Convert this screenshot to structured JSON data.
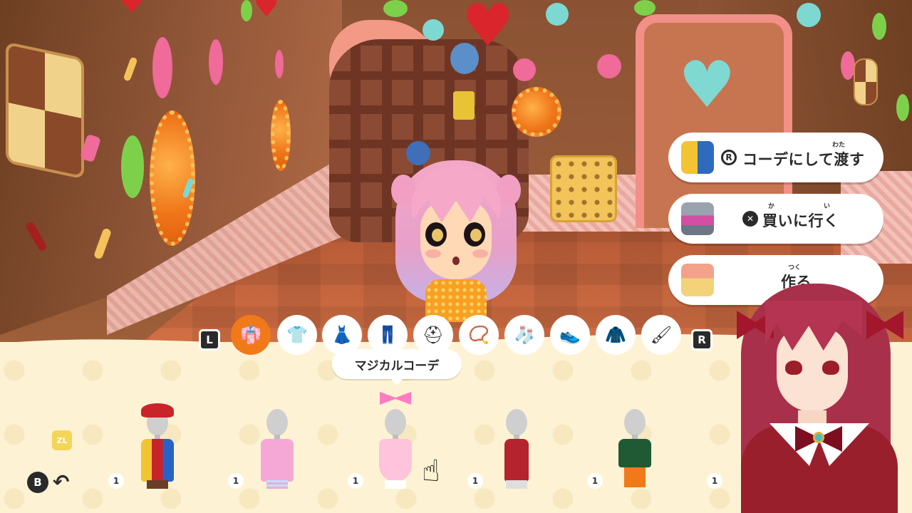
{
  "actions": {
    "coordinate_give": {
      "ruby": "わた",
      "glyph": "R",
      "label": "コーデにして渡す"
    },
    "go_buy": {
      "ruby_ka": "か",
      "ruby_i": "い",
      "glyph": "✕",
      "label": "買いに行く"
    },
    "make": {
      "ruby": "つく",
      "label": "作る"
    }
  },
  "category_tabs": {
    "left_shoulder": "L",
    "right_shoulder": "R",
    "items": [
      {
        "icon": "outfit-set-icon",
        "glyph": "👘",
        "active": true
      },
      {
        "icon": "tshirt-icon",
        "glyph": "👕",
        "active": false
      },
      {
        "icon": "dress-icon",
        "glyph": "👗",
        "active": false
      },
      {
        "icon": "pants-icon",
        "glyph": "👖",
        "active": false
      },
      {
        "icon": "hat-icon",
        "glyph": "⛑",
        "active": false
      },
      {
        "icon": "necklace-icon",
        "glyph": "📿",
        "active": false
      },
      {
        "icon": "sock-icon",
        "glyph": "🧦",
        "active": false
      },
      {
        "icon": "shoe-icon",
        "glyph": "👟",
        "active": false
      },
      {
        "icon": "coat-icon",
        "glyph": "🧥",
        "active": false
      },
      {
        "icon": "paint-brush-icon",
        "glyph": "🖌",
        "active": false
      }
    ]
  },
  "tooltip": "マジカルコーデ",
  "outfits": [
    {
      "name": "patchwork-outfit",
      "count": "1",
      "color": "#c8242a",
      "accent": "#2a62c4"
    },
    {
      "name": "pastel-sweater-outfit",
      "count": "1",
      "color": "#f5a8d6",
      "accent": "#b9e4ff"
    },
    {
      "name": "magical-outfit",
      "count": "1",
      "color": "#ffc3dc",
      "accent": "#ff7cc0"
    },
    {
      "name": "red-dress-outfit",
      "count": "1",
      "color": "#b4232e",
      "accent": "#8a1a22"
    },
    {
      "name": "green-jacket-outfit",
      "count": "1",
      "color": "#1f5a34",
      "accent": "#f07a1a"
    }
  ],
  "extra_count": "1",
  "zl_label": "ZL",
  "back_glyph": "B",
  "colors": {
    "panel": "#fdf3d4",
    "active_tab": "#f07a1a",
    "button_bg": "#ffffff"
  }
}
